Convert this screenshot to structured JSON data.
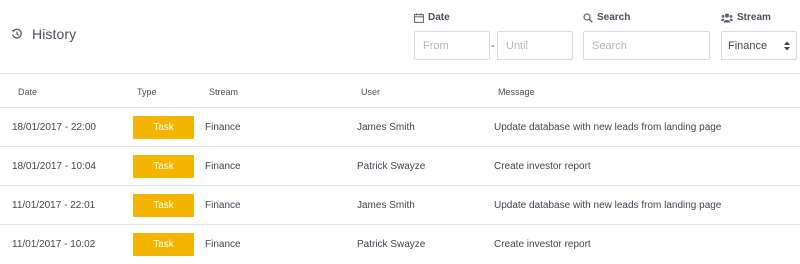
{
  "header": {
    "title": "History",
    "title_icon": "history-icon"
  },
  "filters": {
    "date": {
      "label": "Date",
      "icon": "calendar-icon",
      "from_placeholder": "From",
      "until_placeholder": "Until",
      "separator": "-"
    },
    "search": {
      "label": "Search",
      "icon": "search-icon",
      "placeholder": "Search"
    },
    "stream": {
      "label": "Stream",
      "icon": "users-icon",
      "selected": "Finance"
    }
  },
  "table": {
    "columns": [
      "Date",
      "Type",
      "Stream",
      "User",
      "Message"
    ],
    "rows": [
      {
        "date": "18/01/2017 - 22:00",
        "type": "Task",
        "stream": "Finance",
        "user": "James Smith",
        "message": "Update database with new leads from landing page"
      },
      {
        "date": "18/01/2017 - 10:04",
        "type": "Task",
        "stream": "Finance",
        "user": "Patrick Swayze",
        "message": "Create investor report"
      },
      {
        "date": "11/01/2017 - 22:01",
        "type": "Task",
        "stream": "Finance",
        "user": "James Smith",
        "message": "Update database with new leads from landing page"
      },
      {
        "date": "11/01/2017 - 10:02",
        "type": "Task",
        "stream": "Finance",
        "user": "Patrick Swayze",
        "message": "Create investor report"
      }
    ]
  },
  "colors": {
    "badge": "#f4b400",
    "border": "#e1e4e8",
    "text": "#3f4650"
  }
}
